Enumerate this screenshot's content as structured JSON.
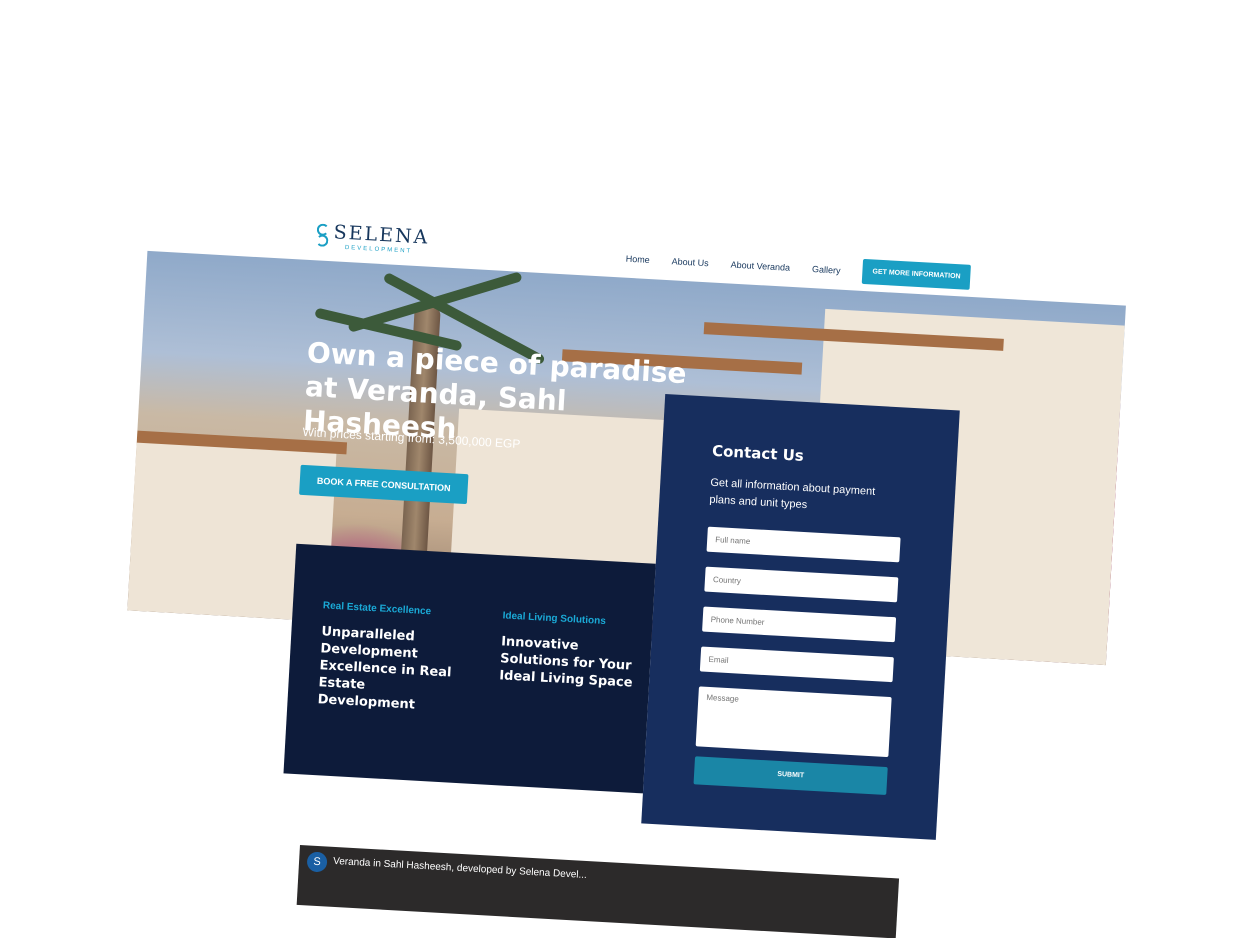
{
  "brand": {
    "name": "SELENA",
    "tagline": "DEVELOPMENT"
  },
  "nav": {
    "items": [
      "Home",
      "About Us",
      "About Veranda",
      "Gallery"
    ],
    "cta": "GET MORE INFORMATION"
  },
  "hero": {
    "title": "Own a piece of paradise at Veranda, Sahl Hasheesh",
    "subtitle": "With prices starting from: 3,500,000 EGP",
    "button": "BOOK A FREE CONSULTATION"
  },
  "features": [
    {
      "label": "Real Estate Excellence",
      "text": "Unparalleled Development Excellence in Real Estate Development"
    },
    {
      "label": "Ideal Living Solutions",
      "text": "Innovative Solutions for Your Ideal Living Space"
    }
  ],
  "contact": {
    "title": "Contact Us",
    "subtitle": "Get all information about payment plans and unit types",
    "fields": {
      "full_name": "Full name",
      "country": "Country",
      "phone": "Phone Number",
      "email": "Email",
      "message": "Message"
    },
    "submit": "SUBMIT"
  },
  "video": {
    "channel_initial": "S",
    "title": "Veranda in Sahl Hasheesh, developed by Selena Devel..."
  },
  "colors": {
    "accent": "#1a9fc4",
    "navy": "#0d1b3a",
    "form_bg": "#172e5e"
  }
}
